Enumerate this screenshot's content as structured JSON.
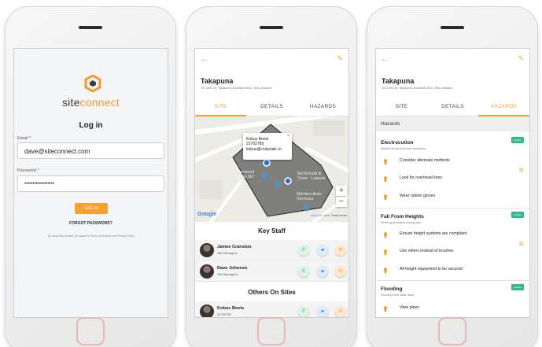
{
  "login": {
    "brand_prefix": "site",
    "brand_suffix": "connect",
    "title": "Log in",
    "email_label": "Email *",
    "email_value": "dave@siteconnect.com",
    "password_label": "Password *",
    "password_value": "••••••••••••••••••",
    "login_button": "LOG IN",
    "forgot_password": "FORGOT PASSWORD?",
    "terms": "By using SiteConnect, you agree to Terms of Services and Privacy Policy"
  },
  "site": {
    "title": "Takapuna",
    "address": "19 Como St, Takapuna, Auckland 0622, New Zealand",
    "tabs": [
      "SITE",
      "DETAILS",
      "HAZARDS"
    ]
  },
  "map": {
    "popup_name": "Kobus Beets",
    "popup_phone": "21702789",
    "popup_email": "kobus@codyslab.co",
    "popup_close": "×",
    "labels": {
      "hotel": "Quest Serviced\nApartments NZ",
      "mcdonald": "McDonald &\nSons - Lawyer",
      "michies": "Michies Auto\nServices"
    },
    "google": "Google",
    "map_data": "Map Data",
    "scale": "10 m",
    "terms": "Terms of Use",
    "zoom_in": "+",
    "zoom_out": "−"
  },
  "key_staff": {
    "title": "Key Staff",
    "people": [
      {
        "name": "James Cranston",
        "role": "Site Managers"
      },
      {
        "name": "Dave Johnson",
        "role": "Site Managers"
      }
    ]
  },
  "others": {
    "title": "Others On Sites",
    "people": [
      {
        "name": "Kobus Beets",
        "role": "21702789"
      }
    ]
  },
  "hazards": {
    "header": "Hazards",
    "badge": "Verified",
    "groups": [
      {
        "title": "Electrocution",
        "subtitle": "Electric shock from live machinery",
        "items": [
          "Consider alternate methods",
          "Look for overhead lines",
          "Wear rubber gloves"
        ]
      },
      {
        "title": "Fall From Heights",
        "subtitle": "Working at heights during task",
        "items": [
          "Ensure height systems are compliant",
          "Use rollers instead of brushes",
          "All height equipment to be secured"
        ]
      },
      {
        "title": "Flooding",
        "subtitle": "Flooding from water tank",
        "items": [
          "View plans"
        ]
      }
    ]
  },
  "colors": {
    "accent": "#f5a033",
    "verified": "#2fbd85"
  },
  "icons": {
    "back": "←",
    "edit": "✎",
    "call": "✆",
    "chat": "▰",
    "mail": "✉",
    "open": "⧉"
  }
}
